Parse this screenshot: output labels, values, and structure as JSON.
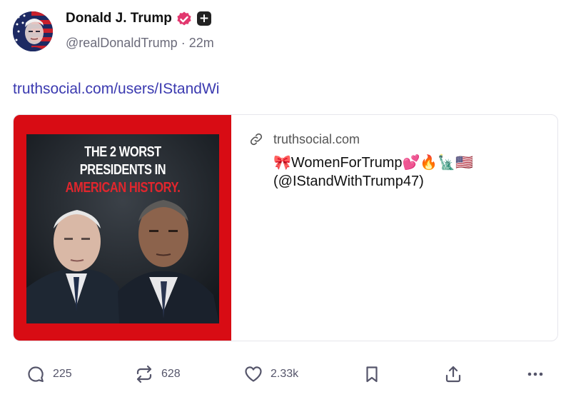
{
  "author": {
    "name": "Donald J. Trump",
    "handle": "@realDonaldTrump",
    "separator": "·",
    "time": "22m"
  },
  "post": {
    "link_text": "truthsocial.com/users/IStandWi"
  },
  "card": {
    "domain": "truthsocial.com",
    "title_line1": "🎀WomenForTrump💕🔥🗽🇺🇸",
    "title_line2": "(@IStandWithTrump47)",
    "image_headline": {
      "line1": "THE 2 WORST",
      "line2": "PRESIDENTS IN",
      "line3": "AMERICAN HISTORY."
    }
  },
  "actions": {
    "replies": "225",
    "retruths": "628",
    "likes": "2.33k"
  },
  "icons": {
    "verified": "verified-badge-icon",
    "plus": "plus-badge-icon",
    "link": "link-icon",
    "reply": "reply-icon",
    "retruth": "retruth-icon",
    "like": "heart-icon",
    "bookmark": "bookmark-icon",
    "share": "share-icon",
    "more": "more-icon"
  },
  "colors": {
    "link": "#3b3ab0",
    "verified": "#e2376e",
    "card_frame": "#d80c14",
    "muted": "#6b6b7a"
  }
}
